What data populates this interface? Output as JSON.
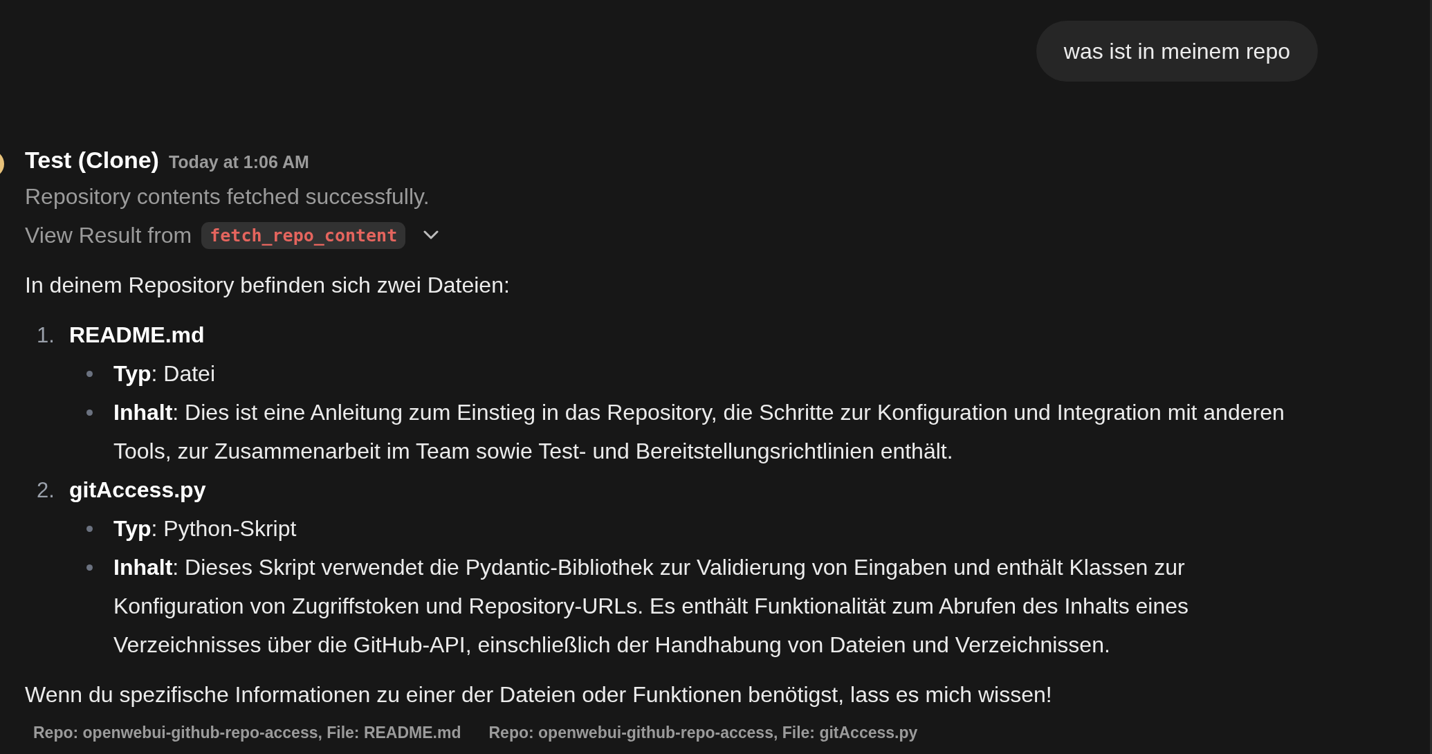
{
  "user_message": {
    "text": "was ist in meinem repo"
  },
  "assistant_message": {
    "name": "Test (Clone)",
    "timestamp": "Today at 1:06 AM",
    "status": "Repository contents fetched successfully.",
    "tool_result": {
      "label": "View Result from",
      "tool": "fetch_repo_content",
      "expanded": false
    },
    "intro": "In deinem Repository befinden sich zwei Dateien:",
    "files": [
      {
        "number": "1.",
        "name": "README.md",
        "details": [
          "**Typ**: Datei",
          "**Inhalt**: Dies ist eine Anleitung zum Einstieg in das Repository, die Schritte zur Konfiguration und Integration mit anderen Tools, zur Zusammenarbeit im Team sowie Test- und Bereitstellungsrichtlinien enthält."
        ]
      },
      {
        "number": "2.",
        "name": "gitAccess.py",
        "details": [
          "**Typ**: Python-Skript",
          "**Inhalt**: Dieses Skript verwendet die Pydantic-Bibliothek zur Validierung von Eingaben und enthält Klassen zur Konfiguration von Zugriffstoken und Repository-URLs. Es enthält Funktionalität zum Abrufen des Inhalts eines Verzeichnisses über die GitHub-API, einschließlich der Handhabung von Dateien und Verzeichnissen."
        ]
      }
    ],
    "closing": "Wenn du spezifische Informationen zu einer der Dateien oder Funktionen benötigst, lass es mich wissen!",
    "citations": [
      "Repo: openwebui-github-repo-access, File: README.md",
      "Repo: openwebui-github-repo-access, File: gitAccess.py"
    ]
  }
}
